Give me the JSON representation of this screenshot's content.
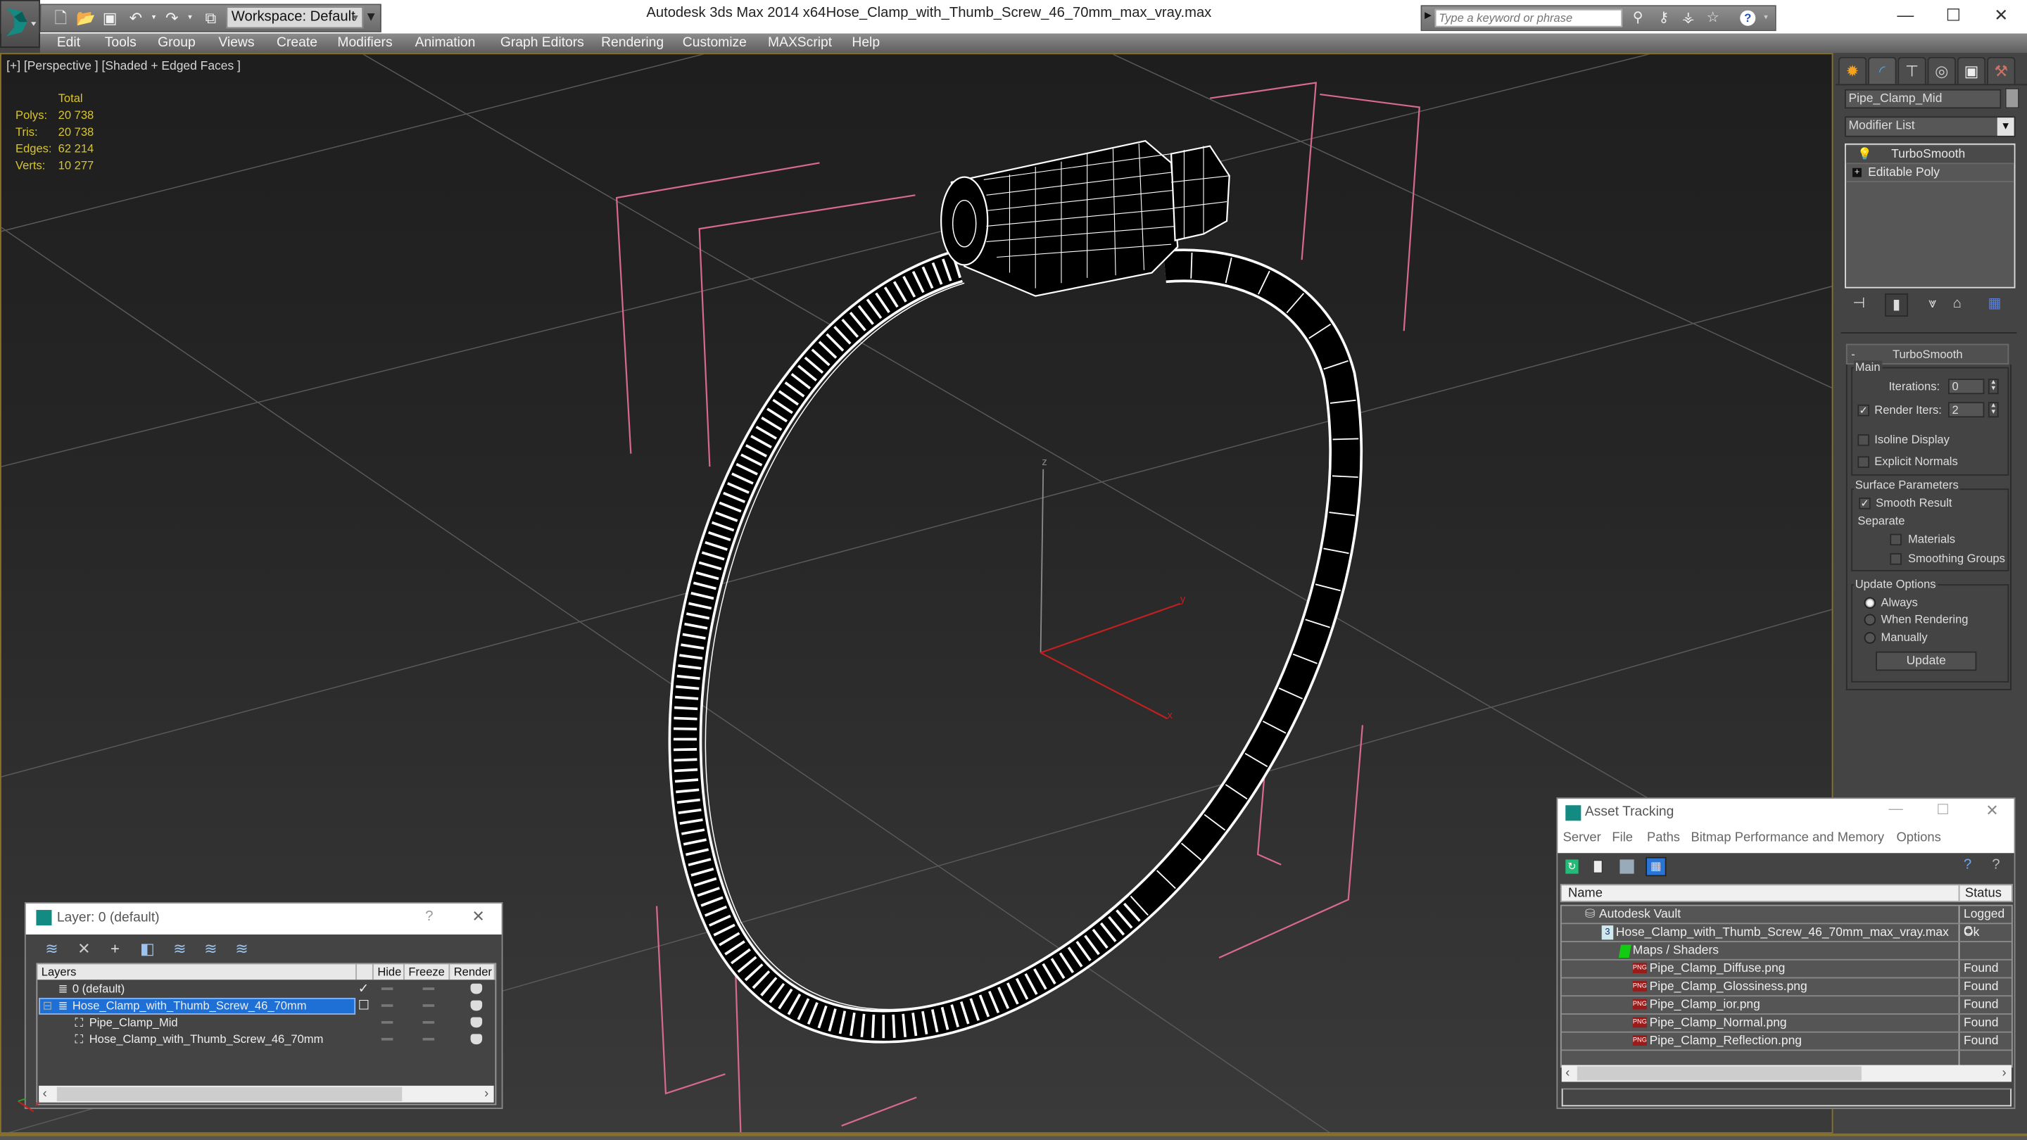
{
  "titlebar": {
    "app_title": "Autodesk 3ds Max  2014 x64",
    "file_title": "Hose_Clamp_with_Thumb_Screw_46_70mm_max_vray.max",
    "workspace": "Workspace: Default",
    "search_placeholder": "Type a keyword or phrase",
    "quick_access_icons": [
      "new-file-icon",
      "open-folder-icon",
      "save-icon",
      "undo-icon",
      "redo-icon",
      "project-folder-icon"
    ],
    "search_icons": [
      "binoculars-icon",
      "key-icon",
      "satellite-icon",
      "star-icon",
      "help-icon"
    ],
    "window_controls": {
      "minimize": "—",
      "maximize": "☐",
      "close": "✕"
    }
  },
  "menubar": {
    "items": [
      "Edit",
      "Tools",
      "Group",
      "Views",
      "Create",
      "Modifiers",
      "Animation",
      "Graph Editors",
      "Rendering",
      "Customize",
      "MAXScript",
      "Help"
    ]
  },
  "viewport": {
    "label": "[+] [Perspective ] [Shaded + Edged Faces ]",
    "stats": {
      "header": "Total",
      "rows": [
        {
          "label": "Polys:",
          "value": "20 738"
        },
        {
          "label": "Tris:",
          "value": "20 738"
        },
        {
          "label": "Edges:",
          "value": "62 214"
        },
        {
          "label": "Verts:",
          "value": "10 277"
        }
      ]
    },
    "axes": {
      "z": "z",
      "y": "y",
      "x": "x"
    },
    "colors": {
      "selection_bracket": "#d86a8c",
      "axis": "#c02020",
      "wire": "#ffffff",
      "stats_text": "#d7c52c"
    }
  },
  "command_panel": {
    "tabs": [
      "create-icon",
      "modify-icon",
      "hierarchy-icon",
      "motion-icon",
      "display-icon",
      "utilities-icon"
    ],
    "object_name": "Pipe_Clamp_Mid",
    "modifier_list": "Modifier List",
    "stack": [
      {
        "label": "TurboSmooth",
        "icon": "lightbulb-icon"
      },
      {
        "label": "Editable Poly",
        "icon": "expand-plus-icon"
      }
    ],
    "rollout": {
      "title": "TurboSmooth",
      "collapse": "-",
      "main_label": "Main",
      "iterations_label": "Iterations:",
      "iterations_value": "0",
      "render_iters_label": "Render Iters:",
      "render_iters_value": "2",
      "render_iters_checked": true,
      "isoline_label": "Isoline Display",
      "isoline_checked": false,
      "explicit_label": "Explicit Normals",
      "explicit_checked": false,
      "surface_label": "Surface Parameters",
      "smooth_result_label": "Smooth Result",
      "smooth_result_checked": true,
      "separate_label": "Separate",
      "materials_label": "Materials",
      "smoothing_groups_label": "Smoothing Groups",
      "update_options_label": "Update Options",
      "update_options": [
        "Always",
        "When Rendering",
        "Manually"
      ],
      "update_selected": "Always",
      "update_button": "Update"
    }
  },
  "layer_window": {
    "title": "Layer: 0 (default)",
    "help": "?",
    "close": "✕",
    "columns": [
      "Layers",
      "",
      "Hide",
      "Freeze",
      "Render"
    ],
    "rows": [
      {
        "name": "0 (default)",
        "active": "✓",
        "selected": false,
        "indent": 1,
        "icon": "layer-icon"
      },
      {
        "name": "Hose_Clamp_with_Thumb_Screw_46_70mm",
        "active": "☐",
        "selected": true,
        "indent": 1,
        "icon": "layer-icon",
        "expand": "⊟"
      },
      {
        "name": "Pipe_Clamp_Mid",
        "active": "",
        "selected": false,
        "indent": 2,
        "icon": "object-icon"
      },
      {
        "name": "Hose_Clamp_with_Thumb_Screw_46_70mm",
        "active": "",
        "selected": false,
        "indent": 2,
        "icon": "object-icon"
      }
    ]
  },
  "asset_window": {
    "title": "Asset Tracking",
    "menu": [
      "Server",
      "File",
      "Paths",
      "Bitmap Performance and Memory",
      "Options"
    ],
    "columns": [
      "Name",
      "Status"
    ],
    "rows": [
      {
        "name": "Autodesk Vault",
        "status": "Logged C",
        "indent": 1,
        "icon": "vault-icon"
      },
      {
        "name": "Hose_Clamp_with_Thumb_Screw_46_70mm_max_vray.max",
        "status": "Ok",
        "indent": 2,
        "icon": "max-file-icon"
      },
      {
        "name": "Maps / Shaders",
        "status": "",
        "indent": 3,
        "icon": "maps-icon"
      },
      {
        "name": "Pipe_Clamp_Diffuse.png",
        "status": "Found",
        "indent": 4,
        "icon": "png-icon"
      },
      {
        "name": "Pipe_Clamp_Glossiness.png",
        "status": "Found",
        "indent": 4,
        "icon": "png-icon"
      },
      {
        "name": "Pipe_Clamp_ior.png",
        "status": "Found",
        "indent": 4,
        "icon": "png-icon"
      },
      {
        "name": "Pipe_Clamp_Normal.png",
        "status": "Found",
        "indent": 4,
        "icon": "png-icon"
      },
      {
        "name": "Pipe_Clamp_Reflection.png",
        "status": "Found",
        "indent": 4,
        "icon": "png-icon"
      }
    ],
    "png_badge": "PNG"
  }
}
